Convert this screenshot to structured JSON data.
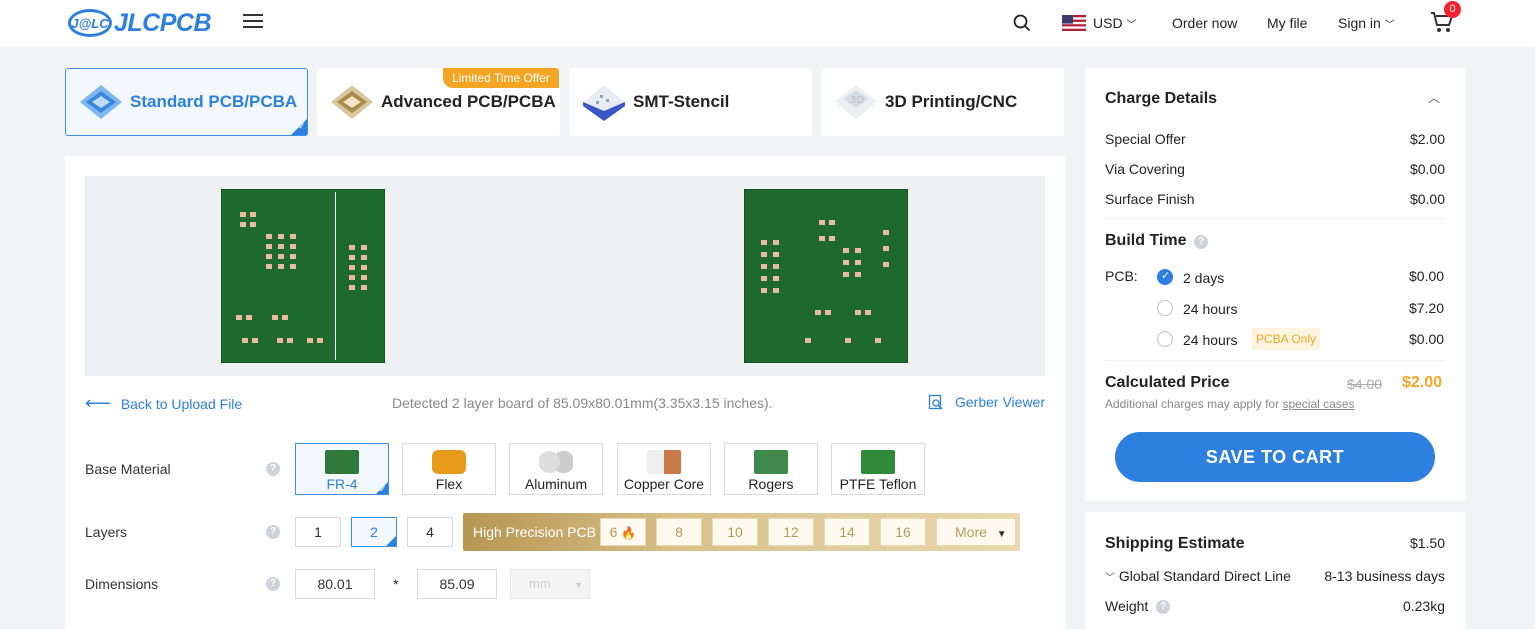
{
  "header": {
    "logo_badge": "J@LC",
    "logo_word": "JLCPCB",
    "currency": "USD",
    "order_now": "Order now",
    "my_file": "My file",
    "sign_in": "Sign in",
    "cart_count": "0"
  },
  "tabs": [
    {
      "label": "Standard PCB/PCBA",
      "active": true
    },
    {
      "label": "Advanced PCB/PCBA",
      "tag": "Limited Time Offer"
    },
    {
      "label": "SMT-Stencil"
    },
    {
      "label": "3D Printing/CNC"
    }
  ],
  "preview": {
    "back_link": "Back to Upload File",
    "detected": "Detected 2 layer board of 85.09x80.01mm(3.35x3.15 inches).",
    "gerber_viewer": "Gerber Viewer"
  },
  "form": {
    "base_material_label": "Base Material",
    "materials": [
      "FR-4",
      "Flex",
      "Aluminum",
      "Copper Core",
      "Rogers",
      "PTFE Teflon"
    ],
    "selected_material": "FR-4",
    "layers_label": "Layers",
    "layers": [
      "1",
      "2",
      "4"
    ],
    "selected_layer": "2",
    "high_precision_label": "High Precision PCB",
    "hp_layers": [
      "6",
      "8",
      "10",
      "12",
      "14",
      "16"
    ],
    "more": "More",
    "dimensions_label": "Dimensions",
    "dim_x": "80.01",
    "dim_sep": "*",
    "dim_y": "85.09",
    "unit": "mm"
  },
  "charge": {
    "title": "Charge Details",
    "items": [
      {
        "label": "Special Offer",
        "value": "$2.00"
      },
      {
        "label": "Via Covering",
        "value": "$0.00"
      },
      {
        "label": "Surface Finish",
        "value": "$0.00"
      }
    ],
    "build_time_title": "Build Time",
    "pcb_label": "PCB:",
    "build_options": [
      {
        "label": "2 days",
        "value": "$0.00",
        "selected": true
      },
      {
        "label": "24 hours",
        "value": "$7.20"
      },
      {
        "label": "24 hours",
        "value": "$0.00",
        "tag": "PCBA Only"
      }
    ],
    "calculated_title": "Calculated Price",
    "old_price": "$4.00",
    "new_price": "$2.00",
    "note": "Additional charges may apply for",
    "note_link": "special cases",
    "save_button": "SAVE TO CART"
  },
  "shipping": {
    "title": "Shipping Estimate",
    "price": "$1.50",
    "method": "Global Standard Direct Line",
    "days": "8-13 business days",
    "weight_label": "Weight",
    "weight": "0.23kg"
  },
  "colors": {
    "accent": "#2d7fe0",
    "price": "#f5a524",
    "offer": "#f5a524",
    "pcb_green": "#1e6a2e"
  }
}
